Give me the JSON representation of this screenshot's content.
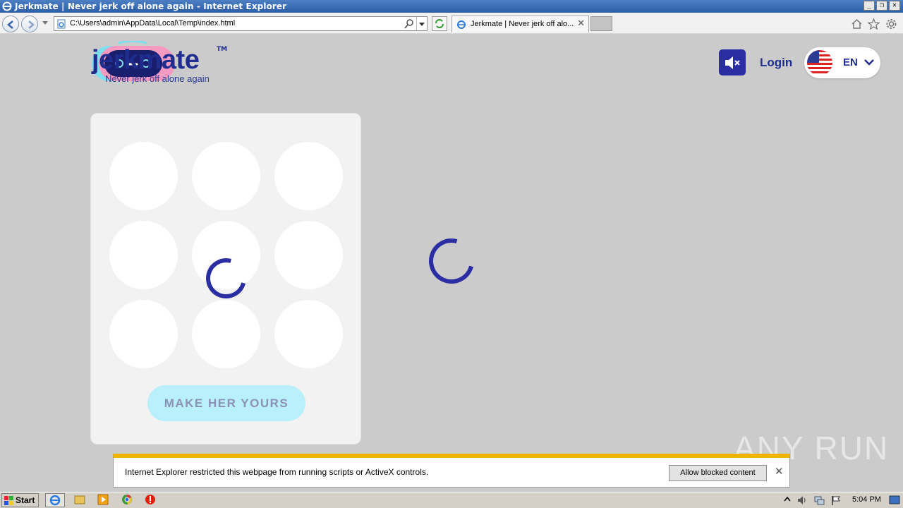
{
  "window": {
    "title": "Jerkmate | Never jerk off alone again - Internet Explorer",
    "controls": [
      "_",
      "❐",
      "✕"
    ]
  },
  "browser": {
    "address": "C:\\Users\\admin\\AppData\\Local\\Temp\\index.html",
    "tab_label": "Jerkmate | Never jerk off alo...",
    "tab_close": "✕"
  },
  "page": {
    "brand": "jerkmate",
    "trademark": "TM",
    "tagline": "Never jerk off alone again",
    "login_label": "Login",
    "language_code": "EN",
    "cta_label": "MAKE HER YOURS",
    "grid_circles": 9,
    "colors": {
      "primary": "#2a2ea2",
      "cta_bg": "#b9f0fb",
      "logo_pink": "#f59ac0",
      "logo_cyan": "#7ee0ee"
    }
  },
  "infobar": {
    "message": "Internet Explorer restricted this webpage from running scripts or ActiveX controls.",
    "allow_label": "Allow blocked content",
    "close": "✕",
    "accent": "#f0b400"
  },
  "watermark": "ANY RUN",
  "taskbar": {
    "start_label": "Start",
    "clock": "5:04 PM",
    "icons": [
      "ie-icon",
      "explorer-icon",
      "media-player-icon",
      "chrome-icon",
      "stop-icon"
    ]
  }
}
